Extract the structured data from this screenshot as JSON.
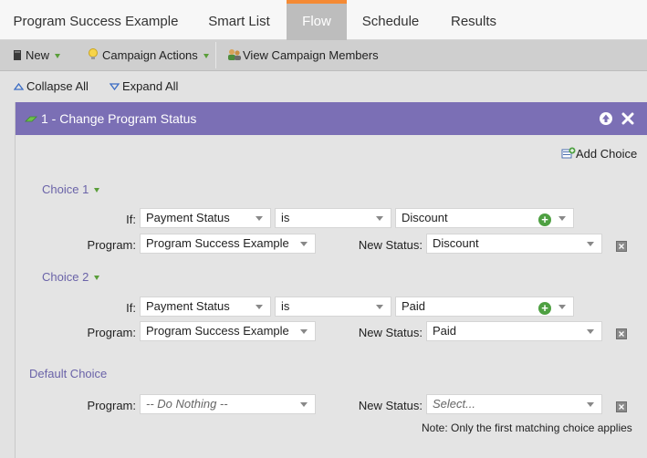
{
  "tabs": {
    "program": "Program Success Example",
    "smart_list": "Smart List",
    "flow": "Flow",
    "schedule": "Schedule",
    "results": "Results"
  },
  "toolbar": {
    "new": "New",
    "campaign_actions": "Campaign Actions",
    "view_members": "View Campaign Members"
  },
  "expand": {
    "collapse_all": "Collapse All",
    "expand_all": "Expand All"
  },
  "panel": {
    "title": "1 - Change Program Status",
    "add_choice": "Add Choice",
    "header_color": "#7b6fb5"
  },
  "labels": {
    "if": "If:",
    "program": "Program:",
    "new_status": "New Status:"
  },
  "choices": [
    {
      "label": "Choice 1",
      "field": "Payment Status",
      "operator": "is",
      "value": "Discount",
      "program": "Program Success Example",
      "new_status": "Discount"
    },
    {
      "label": "Choice 2",
      "field": "Payment Status",
      "operator": "is",
      "value": "Paid",
      "program": "Program Success Example",
      "new_status": "Paid"
    }
  ],
  "default_choice": {
    "label": "Default Choice",
    "program": "-- Do Nothing --",
    "new_status": "Select..."
  },
  "note": "Note: Only the first matching choice applies",
  "icons": [
    "document-icon",
    "lightbulb-icon",
    "people-icon",
    "collapse-triangle-icon",
    "expand-triangle-icon",
    "flow-step-icon",
    "move-up-icon",
    "close-icon",
    "add-choice-icon",
    "add-condition-icon",
    "delete-icon"
  ]
}
